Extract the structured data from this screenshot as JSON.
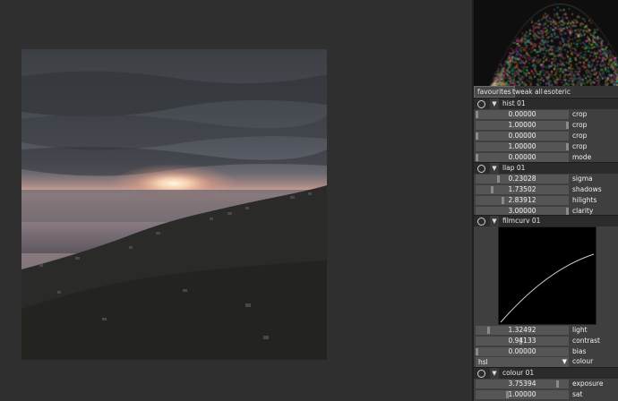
{
  "tabs": [
    "favourites",
    "tweak all",
    "esoteric"
  ],
  "modules": {
    "hist": {
      "name": "hist 01",
      "params": [
        {
          "label": "crop",
          "value": "0.00000",
          "fraction": 0.0
        },
        {
          "label": "crop",
          "value": "1.00000",
          "fraction": 1.0
        },
        {
          "label": "crop",
          "value": "0.00000",
          "fraction": 0.0
        },
        {
          "label": "crop",
          "value": "1.00000",
          "fraction": 1.0
        },
        {
          "label": "mode",
          "value": "0.00000",
          "fraction": 0.0
        }
      ]
    },
    "llap": {
      "name": "llap 01",
      "params": [
        {
          "label": "sigma",
          "value": "0.23028",
          "fraction": 0.23
        },
        {
          "label": "shadows",
          "value": "1.73502",
          "fraction": 0.17
        },
        {
          "label": "hilights",
          "value": "2.83912",
          "fraction": 0.28
        },
        {
          "label": "clarity",
          "value": "3.00000",
          "fraction": 1.0
        }
      ]
    },
    "filmcurv": {
      "name": "filmcurv 01",
      "params": [
        {
          "label": "light",
          "value": "1.32492",
          "fraction": 0.13
        },
        {
          "label": "contrast",
          "value": "0.94133",
          "fraction": 0.47
        },
        {
          "label": "bias",
          "value": "0.00000",
          "fraction": 0.0
        }
      ],
      "combo": {
        "value": "hsl",
        "label": "colour"
      }
    },
    "colour": {
      "name": "colour 01",
      "params": [
        {
          "label": "exposure",
          "value": "3.75394",
          "fraction": 0.87
        },
        {
          "label": "sat",
          "value": "1.00000",
          "fraction": 0.33
        }
      ]
    }
  },
  "icons": {
    "power": "power-icon",
    "expand": "expand-triangle-icon",
    "dropdown": "dropdown-arrow-icon"
  },
  "colors": {
    "panel_bg": "#3f3f3f",
    "module_header": "#2b2b2b",
    "slider_bg": "#555555",
    "slider_knob": "#8a8a8a",
    "curve_line": "#cccccc"
  }
}
